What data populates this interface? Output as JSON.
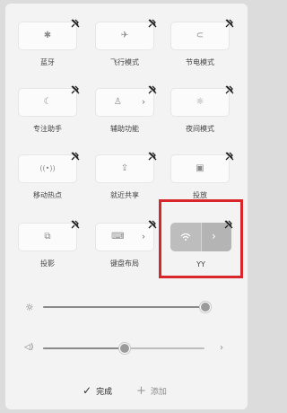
{
  "tiles": [
    {
      "label": "蓝牙",
      "icon": "bluetooth-icon",
      "glyph": "✱"
    },
    {
      "label": "飞行模式",
      "icon": "airplane-icon",
      "glyph": "✈"
    },
    {
      "label": "节电模式",
      "icon": "battery-saver-icon",
      "glyph": "⊂"
    },
    {
      "label": "专注助手",
      "icon": "moon-icon",
      "glyph": "☾"
    },
    {
      "label": "辅助功能",
      "icon": "accessibility-icon",
      "glyph": "♙"
    },
    {
      "label": "夜间模式",
      "icon": "brightness-icon",
      "glyph": "☼"
    },
    {
      "label": "移动热点",
      "icon": "hotspot-icon",
      "glyph": "((•))"
    },
    {
      "label": "就近共享",
      "icon": "share-icon",
      "glyph": "⇪"
    },
    {
      "label": "投放",
      "icon": "cast-icon",
      "glyph": "▣"
    },
    {
      "label": "投影",
      "icon": "project-icon",
      "glyph": "⧉"
    },
    {
      "label": "键盘布局",
      "icon": "keyboard-icon",
      "glyph": "⌨"
    },
    {
      "label": "YY",
      "icon": "wifi-icon",
      "glyph": "◠"
    }
  ],
  "brightness": {
    "icon": "brightness-icon",
    "glyph": "☼",
    "level": 1.0
  },
  "volume": {
    "icon": "speaker-icon",
    "glyph": "◁)",
    "level": 0.5,
    "arrow": "›"
  },
  "footer": {
    "done_icon": "check-icon",
    "done_glyph": "✓",
    "done_label": "完成",
    "add_icon": "plus-icon",
    "add_glyph": "+",
    "add_label": "添加"
  },
  "colors": {
    "highlight": "#d9262b",
    "wifi_tile": "#bdbdbd"
  }
}
